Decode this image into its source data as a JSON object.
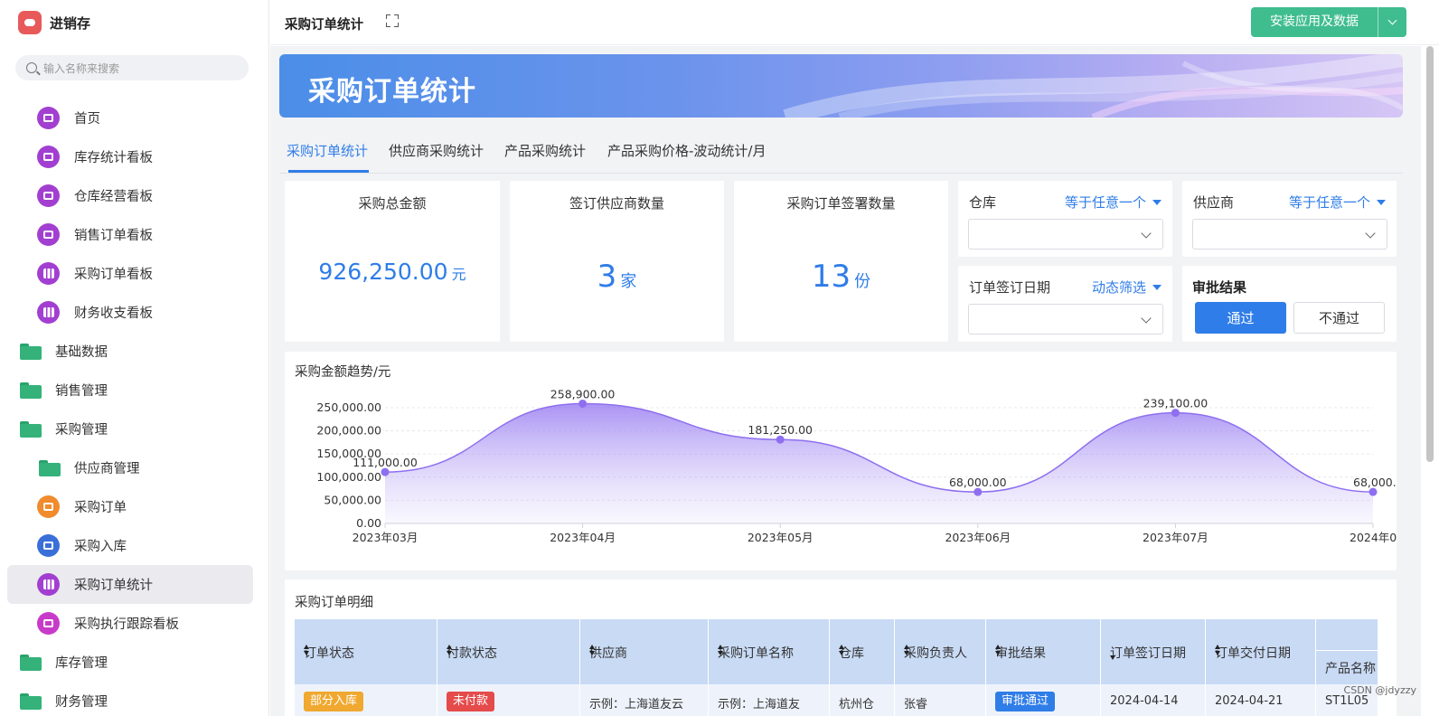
{
  "app": {
    "name": "进销存"
  },
  "search": {
    "placeholder": "输入名称来搜索"
  },
  "nav": [
    {
      "label": "首页",
      "icon": "dashboard-icon",
      "color": "purple",
      "level": 2,
      "kind": "icon"
    },
    {
      "label": "库存统计看板",
      "icon": "dashboard-icon",
      "color": "purple",
      "level": 2,
      "kind": "icon"
    },
    {
      "label": "仓库经营看板",
      "icon": "dashboard-icon",
      "color": "purple",
      "level": 2,
      "kind": "icon"
    },
    {
      "label": "销售订单看板",
      "icon": "dashboard-icon",
      "color": "purple",
      "level": 2,
      "kind": "icon"
    },
    {
      "label": "采购订单看板",
      "icon": "bar-chart-icon",
      "color": "purple",
      "level": 2,
      "kind": "bars"
    },
    {
      "label": "财务收支看板",
      "icon": "bar-chart-icon",
      "color": "purple",
      "level": 2,
      "kind": "bars"
    },
    {
      "label": "基础数据",
      "icon": "folder-icon",
      "level": 1,
      "kind": "folder"
    },
    {
      "label": "销售管理",
      "icon": "folder-icon",
      "level": 1,
      "kind": "folder"
    },
    {
      "label": "采购管理",
      "icon": "folder-icon",
      "level": 1,
      "kind": "folder"
    },
    {
      "label": "供应商管理",
      "icon": "folder-icon",
      "level": 2,
      "kind": "folder"
    },
    {
      "label": "采购订单",
      "icon": "form-icon",
      "color": "orange",
      "level": 2,
      "kind": "icon"
    },
    {
      "label": "采购入库",
      "icon": "document-icon",
      "color": "blue",
      "level": 2,
      "kind": "icon"
    },
    {
      "label": "采购订单统计",
      "icon": "bar-chart-icon",
      "color": "purple",
      "level": 2,
      "kind": "bars",
      "active": true
    },
    {
      "label": "采购执行跟踪看板",
      "icon": "home-icon",
      "color": "pink",
      "level": 2,
      "kind": "icon"
    },
    {
      "label": "库存管理",
      "icon": "folder-icon",
      "level": 1,
      "kind": "folder"
    },
    {
      "label": "财务管理",
      "icon": "folder-icon",
      "level": 1,
      "kind": "folder"
    }
  ],
  "topbar": {
    "title": "采购订单统计",
    "install_label": "安装应用及数据"
  },
  "banner": {
    "title": "采购订单统计"
  },
  "tabs": [
    "采购订单统计",
    "供应商采购统计",
    "产品采购统计",
    "产品采购价格-波动统计/月"
  ],
  "stats": [
    {
      "label": "采购总金额",
      "value": "926,250.00",
      "unit": "元"
    },
    {
      "label": "签订供应商数量",
      "value": "3",
      "unit": "家"
    },
    {
      "label": "采购订单签署数量",
      "value": "13",
      "unit": "份"
    }
  ],
  "filters": {
    "warehouse": {
      "label": "仓库",
      "mode": "等于任意一个"
    },
    "supplier": {
      "label": "供应商",
      "mode": "等于任意一个"
    },
    "sign_date": {
      "label": "订单签订日期",
      "mode": "动态筛选"
    },
    "approval": {
      "label": "审批结果",
      "pass": "通过",
      "fail": "不通过"
    }
  },
  "chart": {
    "title": "采购金额趋势/元"
  },
  "chart_data": {
    "type": "area",
    "title": "采购金额趋势/元",
    "x": [
      "2023年03月",
      "2023年04月",
      "2023年05月",
      "2023年06月",
      "2023年07月",
      "2024年0"
    ],
    "values": [
      111000,
      258900,
      181250,
      68000,
      239100,
      68000
    ],
    "value_labels": [
      "111,000.00",
      "258,900.00",
      "181,250.00",
      "68,000.00",
      "239,100.00",
      "68,000."
    ],
    "yticks": [
      "0.00",
      "50,000.00",
      "100,000.00",
      "150,000.00",
      "200,000.00",
      "250,000.00"
    ],
    "ylim": [
      0,
      250000
    ],
    "grid": true,
    "color": "#8e6ff0"
  },
  "table": {
    "title": "采购订单明细",
    "columns": [
      "订单状态",
      "付款状态",
      "供应商",
      "采购订单名称",
      "仓库",
      "采购负责人",
      "审批结果",
      "订单签订日期",
      "订单交付日期",
      "产品名称"
    ],
    "row": [
      "部分入库",
      "未付款",
      "示例：上海道友云",
      "示例：上海道友",
      "杭州仓",
      "张睿",
      "审批通过",
      "2024-04-14",
      "2024-04-21",
      "ST1L05"
    ]
  },
  "watermark": "CSDN @jdyzzy",
  "colors": {
    "accent": "#2f7de8",
    "install": "#3fbd8f",
    "tag_orange": "#f0a830",
    "tag_red": "#e54b4b",
    "tag_blue": "#2f7de8"
  }
}
